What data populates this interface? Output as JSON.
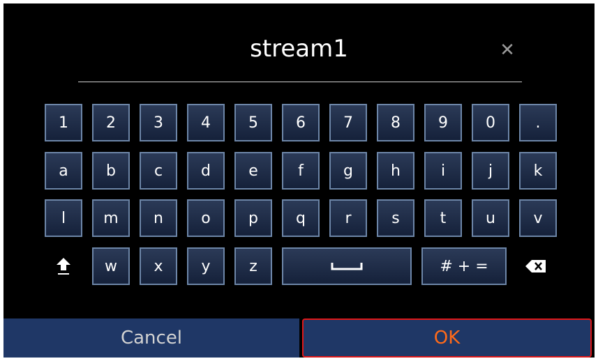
{
  "input": {
    "value": "stream1",
    "clear_icon": "close-icon"
  },
  "keys": {
    "row1": [
      "1",
      "2",
      "3",
      "4",
      "5",
      "6",
      "7",
      "8",
      "9",
      "0",
      "."
    ],
    "row2": [
      "a",
      "b",
      "c",
      "d",
      "e",
      "f",
      "g",
      "h",
      "i",
      "j",
      "k"
    ],
    "row3": [
      "l",
      "m",
      "n",
      "o",
      "p",
      "q",
      "r",
      "s",
      "t",
      "u",
      "v"
    ],
    "row4": [
      "w",
      "x",
      "y",
      "z"
    ],
    "symbols": "# + =",
    "space_icon": "space-icon",
    "shift_icon": "shift-arrow-icon",
    "backspace_icon": "backspace-icon"
  },
  "buttons": {
    "cancel": "Cancel",
    "ok": "OK"
  },
  "colors": {
    "background": "#000000",
    "key_fill": "#1d2a45",
    "key_border": "#6d86a8",
    "bottom_bar": "#1f3766",
    "ok_text": "#ff6a1a",
    "ok_border": "#e01818"
  }
}
